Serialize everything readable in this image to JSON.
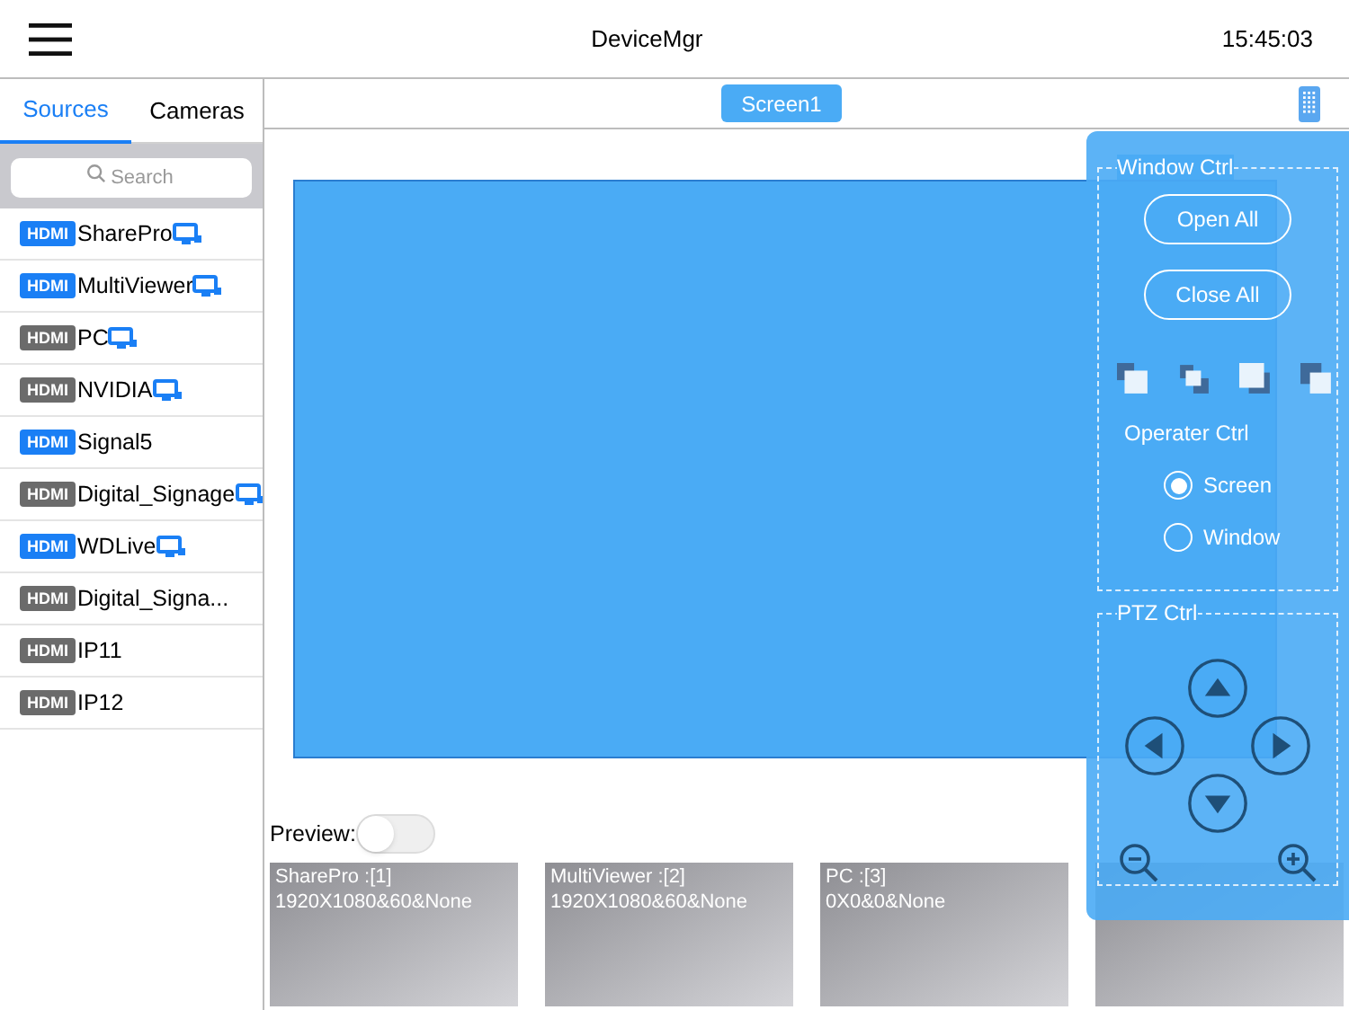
{
  "header": {
    "title": "DeviceMgr",
    "time": "15:45:03"
  },
  "tabs": [
    {
      "label": "Sources",
      "selected": true
    },
    {
      "label": "Cameras",
      "selected": false
    }
  ],
  "search": {
    "placeholder": "Search"
  },
  "sources": [
    {
      "badge": "HDMI",
      "name": "SharePro",
      "active": true,
      "linked": true
    },
    {
      "badge": "HDMI",
      "name": "MultiViewer",
      "active": true,
      "linked": true
    },
    {
      "badge": "HDMI",
      "name": "PC",
      "active": false,
      "linked": true
    },
    {
      "badge": "HDMI",
      "name": "NVIDIA",
      "active": false,
      "linked": true
    },
    {
      "badge": "HDMI",
      "name": "Signal5",
      "active": true,
      "linked": false
    },
    {
      "badge": "HDMI",
      "name": "Digital_Signage",
      "active": false,
      "linked": true
    },
    {
      "badge": "HDMI",
      "name": "WDLive",
      "active": true,
      "linked": true
    },
    {
      "badge": "HDMI",
      "name": "Digital_Signa...",
      "active": false,
      "linked": false
    },
    {
      "badge": "HDMI",
      "name": "IP11",
      "active": false,
      "linked": false
    },
    {
      "badge": "HDMI",
      "name": "IP12",
      "active": false,
      "linked": false
    }
  ],
  "screen_button": "Screen1",
  "preview": {
    "label": "Preview:",
    "on": false
  },
  "thumbnails": [
    {
      "title": "SharePro :[1]",
      "info": "1920X1080&60&None"
    },
    {
      "title": "MultiViewer :[2]",
      "info": "1920X1080&60&None"
    },
    {
      "title": "PC :[3]",
      "info": "0X0&0&None"
    }
  ],
  "panel": {
    "window_ctrl": {
      "title": "Window Ctrl",
      "buttons": [
        "Open All",
        "Close All"
      ]
    },
    "operater_ctrl": {
      "title": "Operater Ctrl",
      "options": [
        {
          "label": "Screen",
          "selected": true
        },
        {
          "label": "Window",
          "selected": false
        }
      ]
    },
    "ptz_ctrl": {
      "title": "PTZ Ctrl"
    }
  }
}
